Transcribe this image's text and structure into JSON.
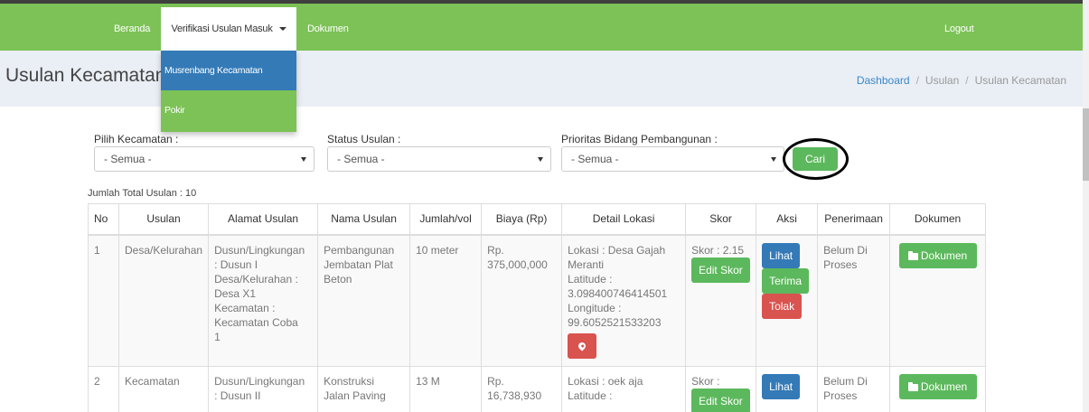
{
  "nav": {
    "beranda": "Beranda",
    "verifikasi": "Verifikasi Usulan Masuk",
    "dokumen": "Dokumen",
    "logout": "Logout"
  },
  "dropdown": {
    "items": [
      "Musrenbang Kecamatan",
      "Pokir"
    ]
  },
  "page": {
    "title": "Usulan Kecamatan"
  },
  "breadcrumb": [
    "Dashboard",
    "Usulan",
    "Usulan Kecamatan"
  ],
  "filters": {
    "kecamatan_label": "Pilih Kecamatan :",
    "kecamatan_value": "- Semua -",
    "status_label": "Status Usulan :",
    "status_value": "- Semua -",
    "prioritas_label": "Prioritas Bidang Pembangunan :",
    "prioritas_value": "- Semua -",
    "search_label": "Cari"
  },
  "total": "Jumlah Total Usulan : 10",
  "table": {
    "headers": [
      "No",
      "Usulan",
      "Alamat Usulan",
      "Nama Usulan",
      "Jumlah/vol",
      "Biaya (Rp)",
      "Detail Lokasi",
      "Skor",
      "Aksi",
      "Penerimaan",
      "Dokumen"
    ],
    "rows": [
      {
        "no": "1",
        "usulan": "Desa/Kelurahan",
        "alamat": [
          "Dusun/Lingkungan",
          ": Dusun I",
          "Desa/Kelurahan :",
          "Desa X1",
          "Kecamatan :",
          "Kecamatan Coba",
          "1"
        ],
        "nama": [
          "Pembangunan",
          "Jembatan Plat",
          "Beton"
        ],
        "jumlah": "10 meter",
        "biaya": [
          "Rp.",
          "375,000,000"
        ],
        "lokasi": [
          "Lokasi : Desa Gajah",
          "Meranti",
          "Latitude :",
          "3.098400746414501",
          "Longitude :",
          "99.6052521533203"
        ],
        "skor": "Skor : 2.15",
        "penerimaan": [
          "Belum Di",
          "Proses"
        ]
      },
      {
        "no": "2",
        "usulan": "Kecamatan",
        "alamat": [
          "Dusun/Lingkungan",
          ": Dusun II"
        ],
        "nama": [
          "Konstruksi",
          "Jalan Paving"
        ],
        "jumlah": "13 M",
        "biaya": [
          "Rp.",
          "16,738,930"
        ],
        "lokasi": [
          "Lokasi : oek aja",
          "Latitude :"
        ],
        "skor": "Skor :",
        "penerimaan": [
          "Belum Di",
          "Proses"
        ]
      }
    ],
    "edit_skor": "Edit Skor",
    "lihat": "Lihat",
    "terima": "Terima",
    "tolak": "Tolak",
    "dokumen_btn": "Dokumen"
  }
}
